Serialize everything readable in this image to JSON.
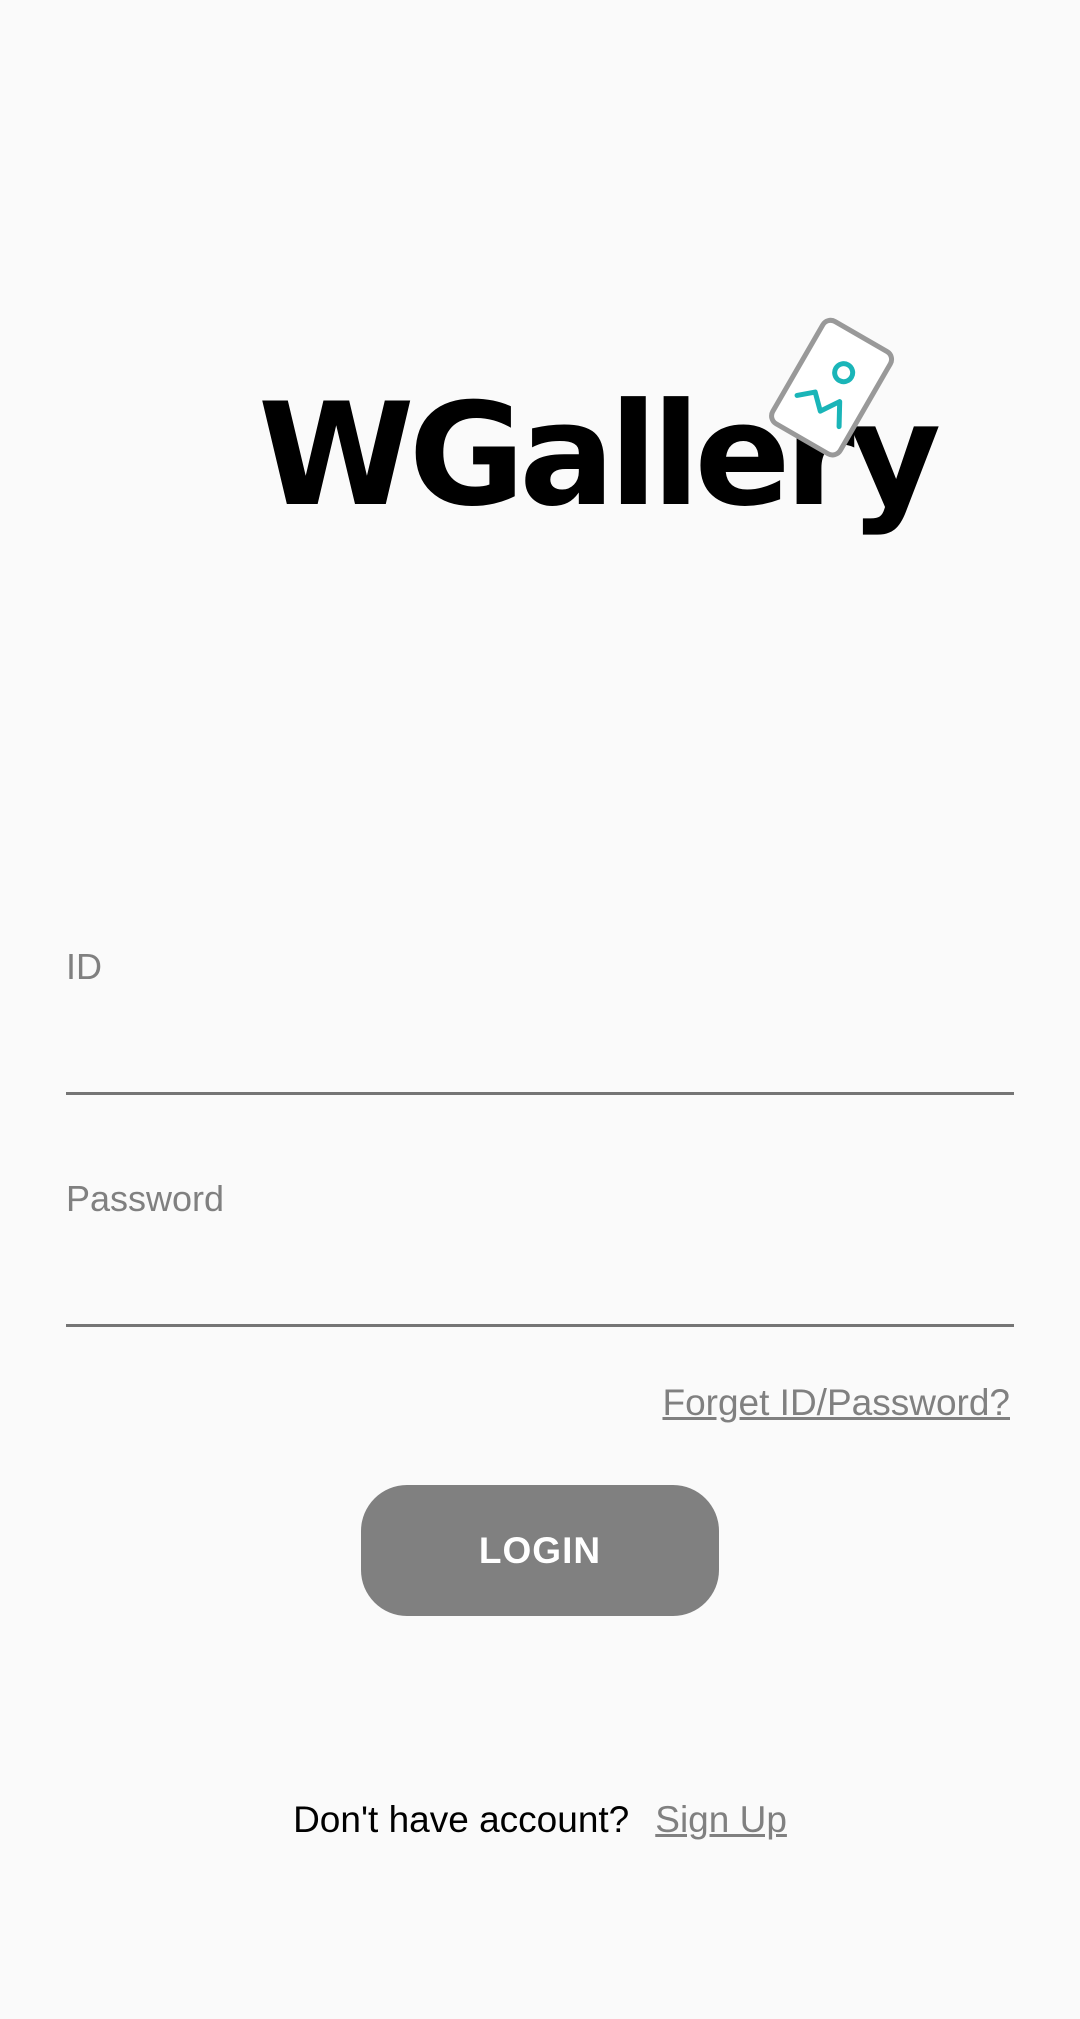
{
  "app": {
    "logo_text": "WGallery",
    "logo_icon": "photo-card-icon"
  },
  "login_form": {
    "id_label": "ID",
    "id_value": "",
    "password_label": "Password",
    "password_value": "",
    "forget_link": "Forget ID/Password?",
    "login_button": "LOGIN"
  },
  "signup": {
    "prompt": "Don't have account?",
    "link": "Sign Up"
  },
  "colors": {
    "background": "#fafafa",
    "muted_gray": "#808080",
    "accent_teal": "#1ab5b8",
    "text_black": "#000000"
  }
}
